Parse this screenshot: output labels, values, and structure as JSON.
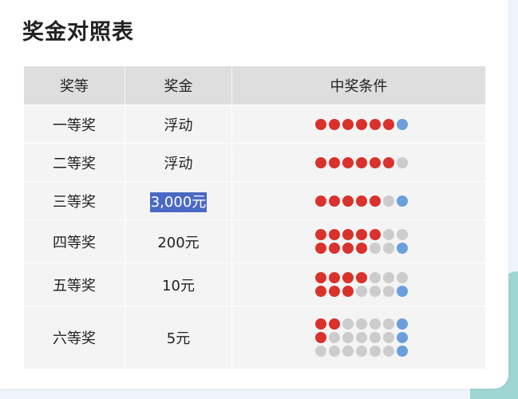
{
  "title": "奖金对照表",
  "table": {
    "headers": [
      "奖等",
      "奖金",
      "中奖条件"
    ],
    "rows": [
      {
        "level": "一等奖",
        "amount": "浮动",
        "combos": [
          [
            "red",
            "red",
            "red",
            "red",
            "red",
            "red",
            "blue"
          ]
        ]
      },
      {
        "level": "二等奖",
        "amount": "浮动",
        "combos": [
          [
            "red",
            "red",
            "red",
            "red",
            "red",
            "red",
            "gray"
          ]
        ]
      },
      {
        "level": "三等奖",
        "amount": "3,000元",
        "combos": [
          [
            "red",
            "red",
            "red",
            "red",
            "red",
            "gray",
            "blue"
          ]
        ]
      },
      {
        "level": "四等奖",
        "amount": "200元",
        "combos": [
          [
            "red",
            "red",
            "red",
            "red",
            "red",
            "gray",
            "gray"
          ],
          [
            "red",
            "red",
            "red",
            "red",
            "gray",
            "gray",
            "blue"
          ]
        ]
      },
      {
        "level": "五等奖",
        "amount": "10元",
        "combos": [
          [
            "red",
            "red",
            "red",
            "red",
            "gray",
            "gray",
            "gray"
          ],
          [
            "red",
            "red",
            "red",
            "gray",
            "gray",
            "gray",
            "blue"
          ]
        ]
      },
      {
        "level": "六等奖",
        "amount": "5元",
        "combos": [
          [
            "red",
            "red",
            "gray",
            "gray",
            "gray",
            "gray",
            "blue"
          ],
          [
            "red",
            "gray",
            "gray",
            "gray",
            "gray",
            "gray",
            "blue"
          ],
          [
            "gray",
            "gray",
            "gray",
            "gray",
            "gray",
            "gray",
            "blue"
          ]
        ]
      }
    ]
  },
  "colors": {
    "red_ball": "#d9312c",
    "blue_ball": "#6a9fdc",
    "gray_ball": "#cccccc",
    "selection": "#4a69c4"
  }
}
